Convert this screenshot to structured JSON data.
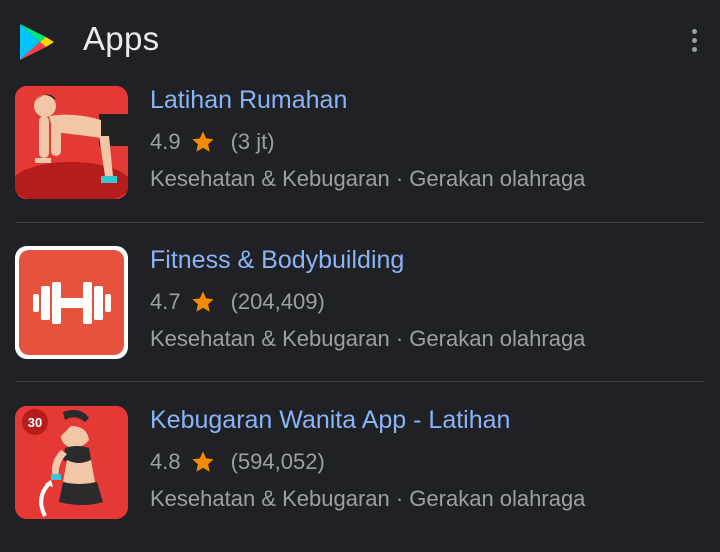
{
  "header": {
    "title": "Apps",
    "logo_icon": "google-play-icon",
    "menu_icon": "more-vertical-icon"
  },
  "apps": [
    {
      "name": "Latihan Rumahan",
      "rating": "4.9",
      "reviews": "(3 jt)",
      "category": "Kesehatan & Kebugaran · Gerakan olahraga",
      "icon": "pushup-man-icon"
    },
    {
      "name": "Fitness & Bodybuilding",
      "rating": "4.7",
      "reviews": "(204,409)",
      "category": "Kesehatan & Kebugaran · Gerakan olahraga",
      "icon": "dumbbell-icon"
    },
    {
      "name": "Kebugaran Wanita App - Latihan",
      "rating": "4.8",
      "reviews": "(594,052)",
      "category": "Kesehatan & Kebugaran · Gerakan olahraga",
      "icon": "woman-fitness-icon",
      "icon_badge": "30"
    }
  ],
  "colors": {
    "background": "#202124",
    "link": "#8ab4f8",
    "secondary_text": "#9aa0a6",
    "star": "#f28b00",
    "icon_red": "#e53935"
  }
}
